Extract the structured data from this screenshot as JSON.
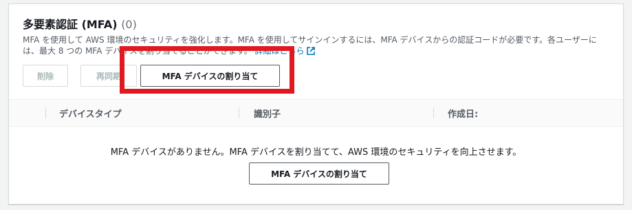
{
  "section": {
    "title": "多要素認証 (MFA)",
    "count": "(0)",
    "description": "MFA を使用して AWS 環境のセキュリティを強化します。MFA を使用してサインインするには、MFA デバイスからの認証コードが必要です。各ユーザーには、最大 8 つの MFA デバイスを割り当てることができます。",
    "learn_more": "詳細はこちら"
  },
  "toolbar": {
    "delete_label": "削除",
    "resync_label": "再同期",
    "assign_label": "MFA デバイスの割り当て"
  },
  "table": {
    "columns": [
      "デバイスタイプ",
      "識別子",
      "作成日:"
    ]
  },
  "empty_state": {
    "message": "MFA デバイスがありません。MFA デバイスを割り当てて、AWS 環境のセキュリティを向上させます。",
    "button_label": "MFA デバイスの割り当て"
  },
  "colors": {
    "highlight": "#e0181f",
    "link": "#0073bb"
  },
  "icons": {
    "external_link": "external-link-icon"
  }
}
